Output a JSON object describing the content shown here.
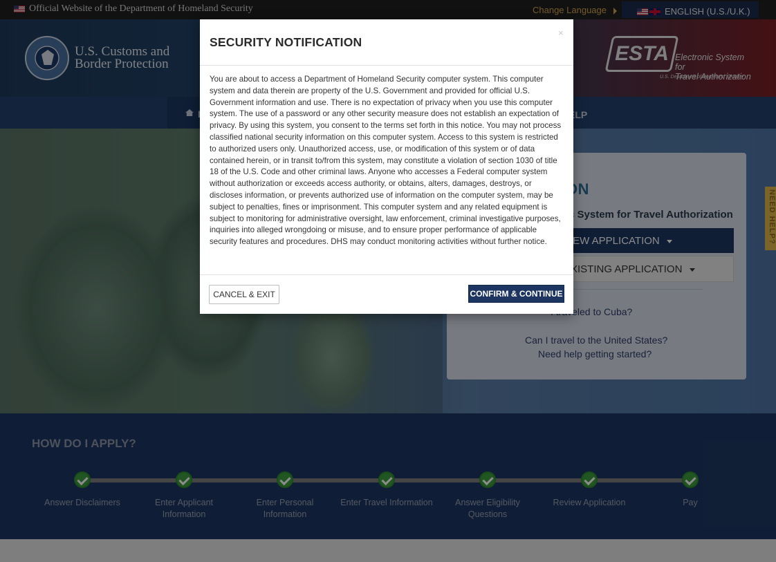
{
  "topbar": {
    "official_text": "Official Website of the Department of Homeland Security",
    "change_language": "Change Language",
    "language": "ENGLISH (U.S./U.K.)"
  },
  "header": {
    "agency_line1": "U.S. Customs and",
    "agency_line2": "Border Protection",
    "esta_mark": "ESTA",
    "esta_line1": "Electronic System for",
    "esta_line2": "Travel Authorization",
    "esta_sub": "U.S. Department of Homeland Security"
  },
  "nav": {
    "home_partial": "I",
    "help_partial": "ELP"
  },
  "card": {
    "title_partial": "ON",
    "subtitle_partial": "c System for Travel Authorization",
    "new_application_partial": "IEW APPLICATION",
    "existing_application_partial": "XISTING APPLICATION",
    "links": [
      "I traveled to Cuba?",
      "Can I travel to the United States?",
      "Need help getting started?"
    ],
    "need_help_tab": "NEED HELP?"
  },
  "apply": {
    "title": "HOW DO I APPLY?",
    "steps": [
      {
        "line1": "Answer Disclaimers",
        "line2": ""
      },
      {
        "line1": "Enter Applicant",
        "line2": "Information"
      },
      {
        "line1": "Enter Personal",
        "line2": "Information"
      },
      {
        "line1": "Enter Travel Information",
        "line2": ""
      },
      {
        "line1": "Answer Eligibility",
        "line2": "Questions"
      },
      {
        "line1": "Review Application",
        "line2": ""
      },
      {
        "line1": "Pay",
        "line2": ""
      }
    ]
  },
  "modal": {
    "title": "SECURITY NOTIFICATION",
    "close": "×",
    "body": "You are about to access a Department of Homeland Security computer system. This computer system and data therein are property of the U.S. Government and provided for official U.S. Government information and use. There is no expectation of privacy when you use this computer system. The use of a password or any other security measure does not establish an expectation of privacy. By using this system, you consent to the terms set forth in this notice. You may not process classified national security information on this computer system. Access to this system is restricted to authorized users only. Unauthorized access, use, or modification of this system or of data contained herein, or in transit to/from this system, may constitute a violation of section 1030 of title 18 of the U.S. Code and other criminal laws. Anyone who accesses a Federal computer system without authorization or exceeds access authority, or obtains, alters, damages, destroys, or discloses information, or prevents authorized use of information on the computer system, may be subject to penalties, fines or imprisonment. This computer system and any related equipment is subject to monitoring for administrative oversight, law enforcement, criminal investigative purposes, inquiries into alleged wrongdoing or misuse, and to ensure proper performance of applicable security features and procedures. DHS may conduct monitoring activities without further notice.",
    "cancel_label": "CANCEL & EXIT",
    "confirm_label": "CONFIRM & CONTINUE"
  },
  "colors": {
    "navy": "#1c3561",
    "accent_gold": "#d6a74a",
    "check_green": "#3c9c3c"
  }
}
